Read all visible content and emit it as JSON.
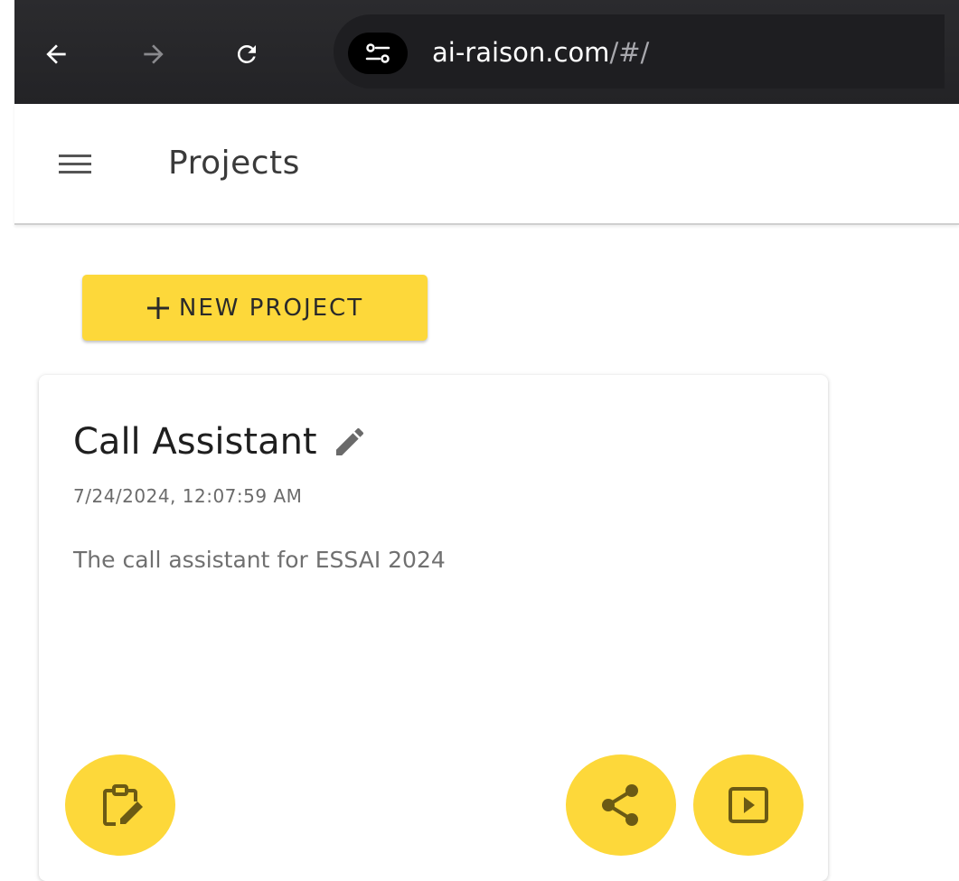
{
  "browser": {
    "url_host": "ai-raison.com",
    "url_path": "/#/",
    "icons": {
      "back": "arrow-left-icon",
      "forward": "arrow-right-icon",
      "reload": "reload-icon",
      "site_info": "tune-icon"
    }
  },
  "app_bar": {
    "title": "Projects",
    "menu_icon": "hamburger-menu-icon"
  },
  "toolbar": {
    "new_project_label": "NEW PROJECT",
    "new_project_icon": "plus-icon"
  },
  "projects": [
    {
      "title": "Call Assistant",
      "timestamp": "7/24/2024, 12:07:59 AM",
      "description": "The call assistant for ESSAI 2024",
      "actions": [
        "edit-clipboard-icon",
        "share-icon",
        "play-icon"
      ]
    }
  ],
  "colors": {
    "accent": "#fdd83a",
    "browser_bar": "#2b2b2e",
    "icon_on_accent": "#6b5a14"
  }
}
